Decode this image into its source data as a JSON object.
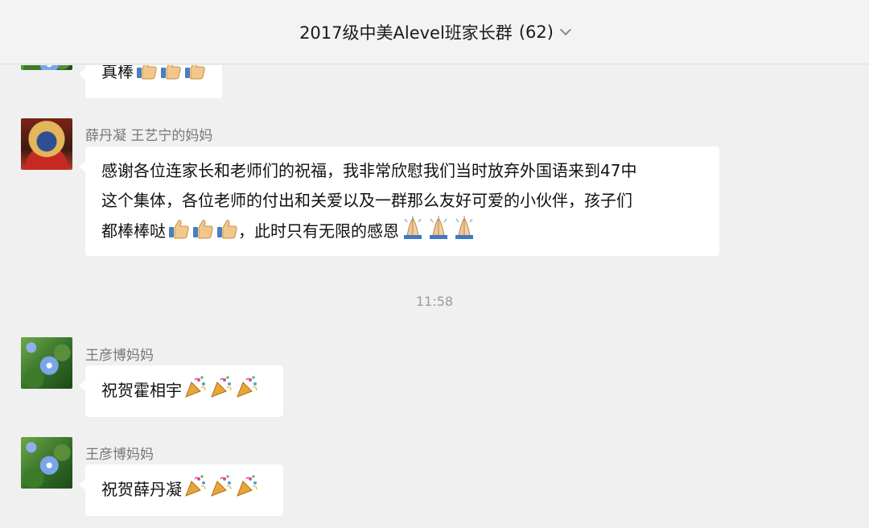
{
  "header": {
    "title": "2017级中美Alevel班家长群",
    "member_count": "(62)"
  },
  "messages": [
    {
      "text": "真棒",
      "emoji": [
        "thumbs-up",
        "thumbs-up",
        "thumbs-up"
      ]
    },
    {
      "sender": "薛丹凝 王艺宁的妈妈",
      "line1": "感谢各位连家长和老师们的祝福，我非常欣慰我们当时放弃外国语来到47中",
      "line2": "这个集体，各位老师的付出和关爱以及一群那么友好可爱的小伙伴，孩子们",
      "line3a": "都棒棒哒",
      "line3b": "，此时只有无限的感恩",
      "emoji_a": [
        "thumbs-up",
        "thumbs-up",
        "thumbs-up"
      ],
      "emoji_b": [
        "folded-hands",
        "folded-hands",
        "folded-hands"
      ]
    },
    {
      "timestamp": "11:58"
    },
    {
      "sender": "王彦博妈妈",
      "text": "祝贺霍相宇",
      "emoji": [
        "party-popper",
        "party-popper",
        "party-popper"
      ]
    },
    {
      "sender": "王彦博妈妈",
      "text": "祝贺薛丹凝",
      "emoji": [
        "party-popper",
        "party-popper",
        "party-popper"
      ]
    }
  ]
}
